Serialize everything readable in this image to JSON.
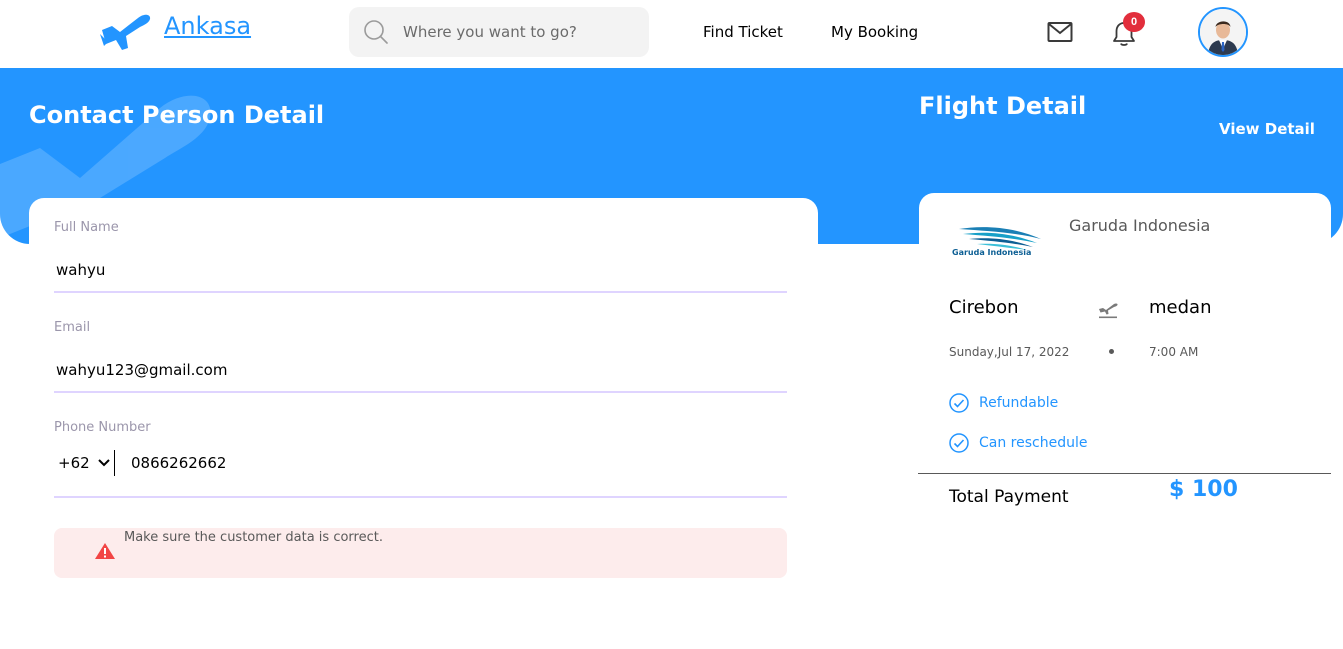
{
  "brand": {
    "name": "Ankasa",
    "color": "#2395FF"
  },
  "search": {
    "placeholder": "Where you want to go?"
  },
  "nav": {
    "find_ticket": "Find Ticket",
    "my_booking": "My Booking"
  },
  "notifications": {
    "count": "0"
  },
  "contact": {
    "title": "Contact Person Detail",
    "full_name": {
      "label": "Full Name",
      "value": "wahyu"
    },
    "email": {
      "label": "Email",
      "value": "wahyu123@gmail.com"
    },
    "phone": {
      "label": "Phone Number",
      "country_code": "+62",
      "value": "0866262662"
    },
    "warning": "Make sure the customer data is correct."
  },
  "flight": {
    "title": "Flight Detail",
    "view_detail": "View Detail",
    "airline": "Garuda Indonesia",
    "airline_logo_text": "Garuda Indonesia",
    "origin": "Cirebon",
    "destination": "medan",
    "date": "Sunday,Jul 17, 2022",
    "time": "7:00 AM",
    "features": [
      "Refundable",
      "Can reschedule"
    ],
    "total_label": "Total Payment",
    "total_value": "$ 100"
  }
}
